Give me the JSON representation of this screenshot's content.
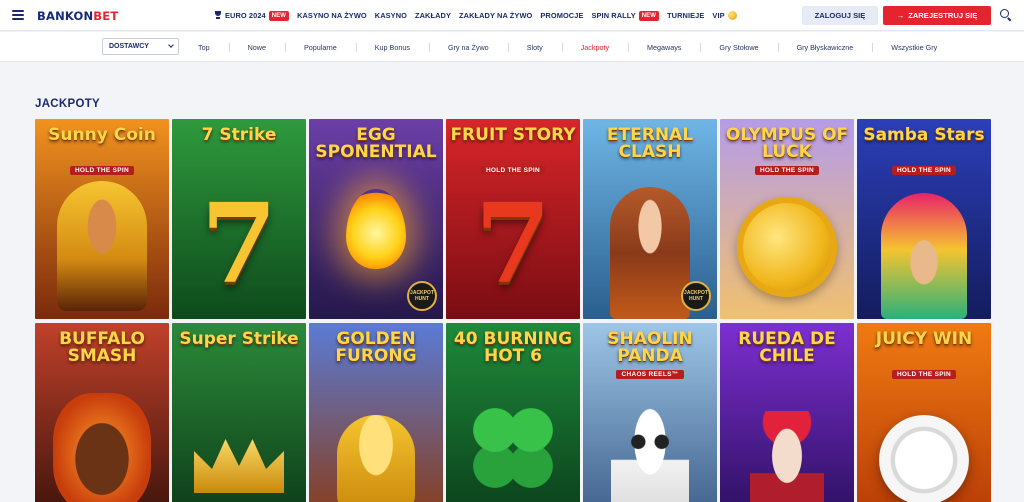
{
  "header": {
    "logo_main": "BANKON",
    "logo_accent": "BET",
    "nav": [
      {
        "label": "EURO 2024",
        "icon": "trophy-icon",
        "badge": "NEW"
      },
      {
        "label": "KASYNO NA ŻYWO"
      },
      {
        "label": "KASYNO"
      },
      {
        "label": "ZAKŁADY"
      },
      {
        "label": "ZAKŁADY NA ŻYWO"
      },
      {
        "label": "PROMOCJE"
      },
      {
        "label": "SPIN RALLY",
        "badge": "NEW"
      },
      {
        "label": "TURNIEJE"
      },
      {
        "label": "VIP",
        "icon": "coin-icon"
      }
    ],
    "login_label": "ZALOGUJ SIĘ",
    "register_label": "ZAREJESTRUJ SIĘ",
    "register_arrow": "→"
  },
  "categories": {
    "provider_dropdown": "DOSTAWCY",
    "items": [
      "Top",
      "Nowe",
      "Popularne",
      "Kup Bonus",
      "Gry na Żywo",
      "Sloty",
      "Jackpoty",
      "Megaways",
      "Gry Stołowe",
      "Gry Błyskawiczne",
      "Wszystkie Gry"
    ],
    "active": "Jackpoty"
  },
  "section": {
    "title": "JACKPOTY"
  },
  "games": [
    {
      "title": "Sunny Coin",
      "subtitle": "HOLD THE SPIN",
      "bg1": "#f2921f",
      "bg2": "#7b2a0c",
      "art": "sun-queen"
    },
    {
      "title": "7 Strike",
      "subtitle": "",
      "bg1": "#2f9a3d",
      "bg2": "#0e4a1c",
      "art": "seven"
    },
    {
      "title": "EGG SPONENTIAL",
      "subtitle": "",
      "bg1": "#6c3fa8",
      "bg2": "#24184a",
      "art": "egg",
      "badge": "JACKPOT HUNT"
    },
    {
      "title": "FRUIT STORY",
      "subtitle": "HOLD THE SPIN",
      "bg1": "#d8262b",
      "bg2": "#7a0d12",
      "art": "seven-fruit"
    },
    {
      "title": "ETERNAL CLASH",
      "subtitle": "",
      "bg1": "#6fb6e6",
      "bg2": "#2a5f8f",
      "art": "warrior",
      "badge": "JACKPOT HUNT"
    },
    {
      "title": "OLYMPUS OF LUCK",
      "subtitle": "HOLD THE SPIN",
      "bg1": "#b59ce8",
      "bg2": "#f0c070",
      "art": "gold-coin"
    },
    {
      "title": "Samba Stars",
      "subtitle": "HOLD THE SPIN",
      "bg1": "#2b3fb8",
      "bg2": "#141c5e",
      "art": "samba"
    },
    {
      "title": "BUFFALO SMASH",
      "subtitle": "",
      "bg1": "#c0412a",
      "bg2": "#3b120b",
      "art": "buffalo"
    },
    {
      "title": "Super Strike",
      "subtitle": "",
      "bg1": "#2c8a3a",
      "bg2": "#0c3a18",
      "art": "crown"
    },
    {
      "title": "GOLDEN FURONG",
      "subtitle": "",
      "bg1": "#5a7bd6",
      "bg2": "#8a3b16",
      "art": "lucky-cat"
    },
    {
      "title": "40 BURNING HOT 6",
      "subtitle": "",
      "bg1": "#1f8a3b",
      "bg2": "#0a3e1a",
      "art": "clover"
    },
    {
      "title": "SHAOLIN PANDA",
      "subtitle": "CHAOS REELS™",
      "bg1": "#9ec6e8",
      "bg2": "#3c5d88",
      "art": "panda"
    },
    {
      "title": "RUEDA DE CHILE",
      "subtitle": "",
      "bg1": "#7d2fd0",
      "bg2": "#2a0f5e",
      "art": "calavera"
    },
    {
      "title": "JUICY WIN",
      "subtitle": "HOLD THE SPIN",
      "bg1": "#f07a12",
      "bg2": "#b63a06",
      "art": "chip"
    }
  ]
}
